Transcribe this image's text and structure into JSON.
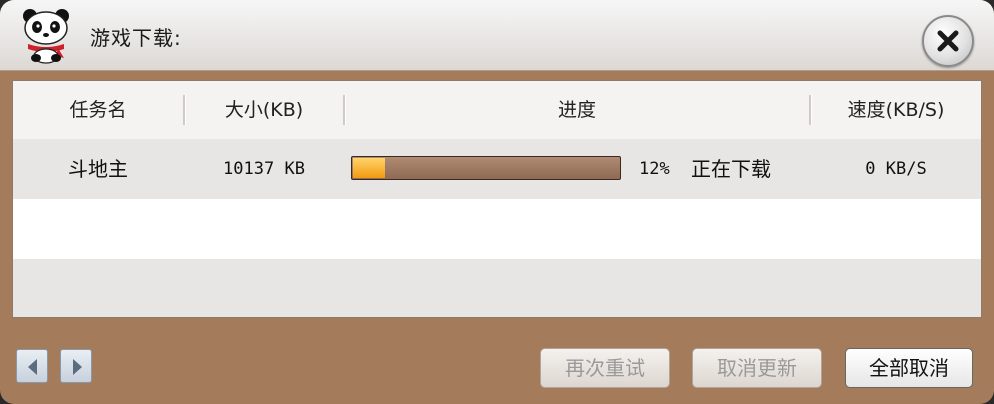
{
  "window": {
    "title": "游戏下载:"
  },
  "table": {
    "columns": [
      "任务名",
      "大小(KB)",
      "进度",
      "速度(KB/S)"
    ],
    "rows": [
      {
        "name": "斗地主",
        "size": "10137 KB",
        "progress_percent": 12,
        "progress_text": "12%",
        "status": "正在下载",
        "speed": "0 KB/S"
      }
    ]
  },
  "footer": {
    "buttons": {
      "retry": "再次重试",
      "cancel_update": "取消更新",
      "cancel_all": "全部取消"
    }
  },
  "icons": {
    "logo": "panda-icon",
    "close": "close-icon",
    "prev": "triangle-left-icon",
    "next": "triangle-right-icon"
  },
  "colors": {
    "frame": "#a47c5b",
    "progress_fill": "#f39a10",
    "progress_track": "#8f6a54"
  }
}
